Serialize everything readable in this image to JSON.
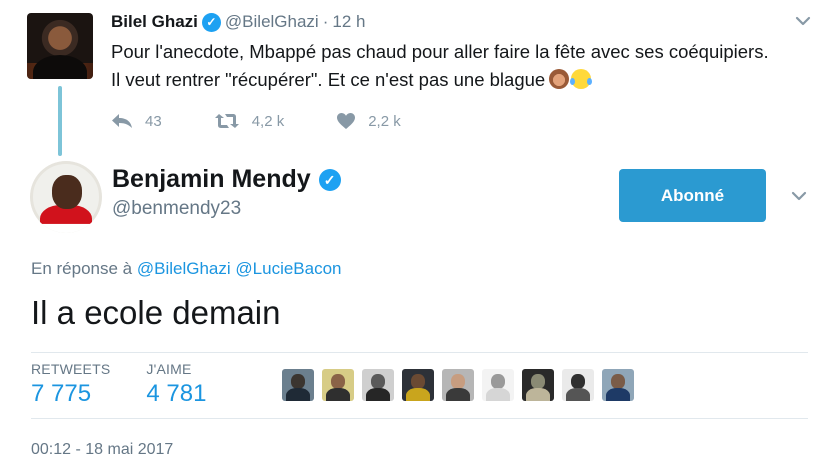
{
  "parent_tweet": {
    "name": "Bilel Ghazi",
    "handle": "@BilelGhazi",
    "separator": "·",
    "time": "12 h",
    "text_line1": "Pour l'anecdote, Mbappé pas chaud pour aller faire la fête avec ses coéquipiers.",
    "text_line2": "Il veut rentrer \"récupérer\". Et ce n'est pas une blague",
    "emojis": [
      "speak-no-evil-monkey-emoji",
      "tears-of-joy-emoji"
    ],
    "actions": {
      "replies": "43",
      "retweets": "4,2 k",
      "likes": "2,2 k"
    }
  },
  "main_tweet": {
    "name": "Benjamin Mendy",
    "handle": "@benmendy23",
    "follow_button": "Abonné",
    "reply_prefix": "En réponse à",
    "reply_mentions": [
      "@BilelGhazi",
      "@LucieBacon"
    ],
    "text": "Il a ecole demain",
    "stats": {
      "retweets_label": "RETWEETS",
      "retweets_value": "7 775",
      "likes_label": "J'AIME",
      "likes_value": "4 781"
    },
    "timestamp": "00:12 - 18 mai 2017"
  },
  "colors": {
    "accent": "#1b95e0",
    "follow_button": "#2b9ad1",
    "thread_line": "#7dc4d8",
    "muted": "#657786",
    "verified": "#1da1f2"
  },
  "icons": {
    "verified": "✓"
  }
}
